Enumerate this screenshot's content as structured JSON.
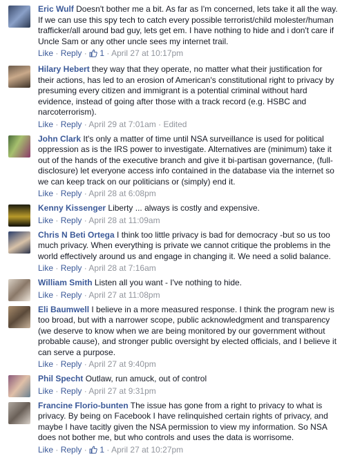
{
  "common": {
    "like": "Like",
    "reply": "Reply",
    "sep": " · ",
    "edited": "Edited"
  },
  "colors": {
    "link": "#3b5998",
    "meta": "#90949c",
    "text": "#141823"
  },
  "comments": [
    {
      "name": "Eric Wulf",
      "text": "Doesn't bother me a bit. As far as I'm concerned, lets take it all the way. If we can use this spy tech to catch every possible terrorist/child molester/human trafficker/all around bad guy, lets get em. I have nothing to hide and i don't care if Uncle Sam or any other uncle sees my internet trail.",
      "likes": "1",
      "time": "April 27 at 10:17pm"
    },
    {
      "name": "Hilary Hebert",
      "text": "they way that they operate, no matter what their justification for their actions, has led to an erosion of American's constitutional right to privacy by presuming every citizen and immigrant is a potential criminal without hard evidence, instead of going after those with a track record (e.g. HSBC and narcoterrorism).",
      "time": "April 29 at 7:01am"
    },
    {
      "name": "John Clark",
      "text": "It's only a matter of time until NSA surveillance is used for political oppression as is the IRS power to investigate. Alternatives are (minimum) take it out of the hands of the executive branch and give it bi-partisan governance, (full-disclosure) let everyone access info contained in the database via the internet so we can keep track on our politicians or (simply) end it.",
      "time": "April 28 at 6:08pm"
    },
    {
      "name": "Kenny Kissenger",
      "text": "Liberty ... always is costly and expensive.",
      "time": "April 28 at 11:09am"
    },
    {
      "name": "Chris N Beti Ortega",
      "text": "I think too little privacy is bad for democracy -but so us too much privacy. When everything is private we cannot critique the problems in the world effectively around us and engage in changing it. We need a solid balance.",
      "time": "April 28 at 7:16am"
    },
    {
      "name": "William Smith",
      "text": "Listen all you want - I've nothing to hide.",
      "time": "April 27 at 11:08pm"
    },
    {
      "name": "Eli Baumwell",
      "text": "I believe in a more measured response. I think the program new is too broad, but with a narrower scope, public acknowledgment and transparency (we deserve to know when we are being monitored by our government without probable cause), and stronger public oversight by elected officials, and I believe it can serve a purpose.",
      "time": "April 27 at 9:40pm"
    },
    {
      "name": "Phil Specht",
      "text": "Outlaw, run amuck, out of control",
      "time": "April 27 at 9:31pm"
    },
    {
      "name": "Francine Florio-bunten",
      "text": "The issue has gone from a right to privacy to what is privacy. By being on Facebook I have relinquished certain rights of privacy, and maybe I have tacitly given the NSA permission to view my information. So NSA does not bother me, but who controls and uses the data is worrisome.",
      "likes": "1",
      "time": "April 27 at 10:27pm"
    }
  ]
}
